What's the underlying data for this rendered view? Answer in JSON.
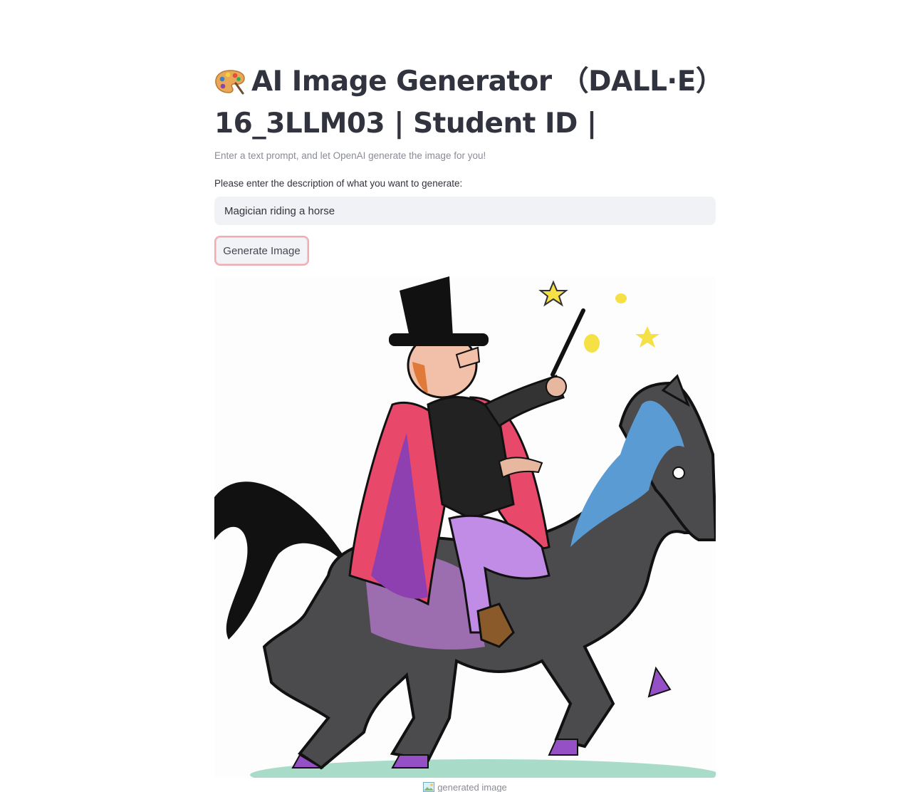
{
  "page": {
    "title": "AI Image Generator （DALL·E）16_3LLM03 | Student ID |",
    "subtitle": "Enter a text prompt, and let OpenAI generate the image for you!"
  },
  "form": {
    "prompt_label": "Please enter the description of what you want to generate:",
    "prompt_value": "Magician riding a horse",
    "generate_button_label": "Generate Image"
  },
  "result": {
    "image_alt": "generated image",
    "caption": "generated image"
  },
  "colors": {
    "accent": "#ff4b4b",
    "input_bg": "#f0f2f6",
    "text": "#31333f",
    "muted_text": "#8a8c96"
  },
  "icons": {
    "title_icon": "artist-palette-icon",
    "caption_icon": "broken-image-icon"
  }
}
